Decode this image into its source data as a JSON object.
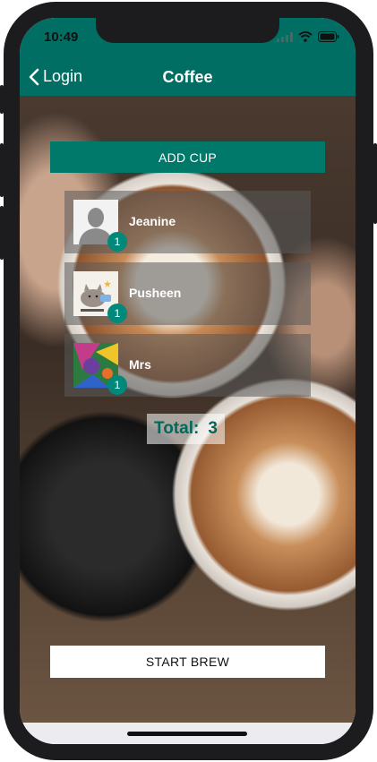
{
  "status_bar": {
    "time": "10:49"
  },
  "nav": {
    "back_label": "Login",
    "title": "Coffee"
  },
  "actions": {
    "add_cup": "ADD CUP",
    "start_brew": "START BREW"
  },
  "participants": [
    {
      "name": "Jeanine",
      "cups": "1",
      "avatar": "default-person-avatar"
    },
    {
      "name": "Pusheen",
      "cups": "1",
      "avatar": "pusheen-cat-avatar"
    },
    {
      "name": "Mrs",
      "cups": "1",
      "avatar": "colorful-illustration-avatar"
    }
  ],
  "total": {
    "label": "Total:",
    "value": "3"
  },
  "colors": {
    "primary": "#00796b",
    "header": "#006e63",
    "badge": "#00897b",
    "total_text": "#00695c"
  }
}
